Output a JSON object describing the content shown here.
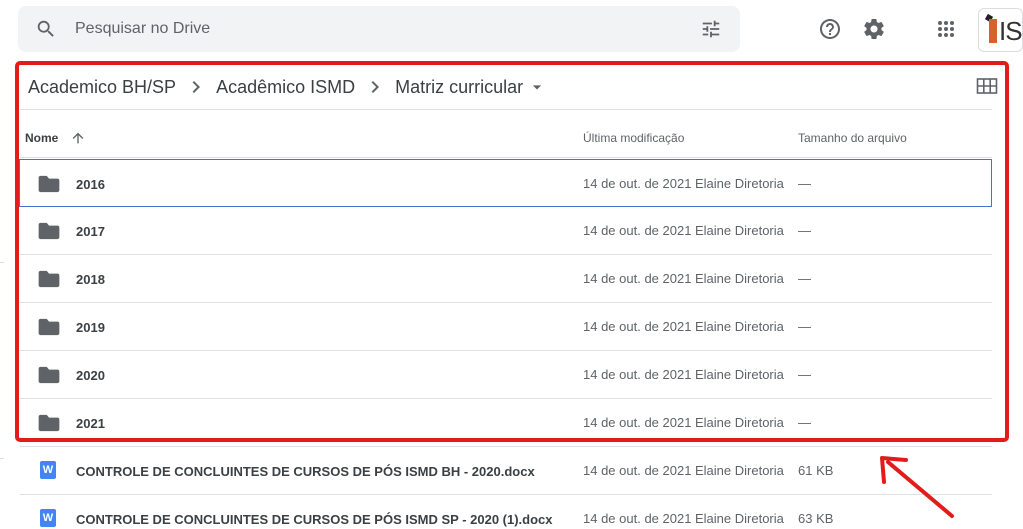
{
  "search": {
    "placeholder": "Pesquisar no Drive"
  },
  "header": {
    "icons": [
      "search-icon",
      "tune-icon",
      "help-icon",
      "gear-icon",
      "apps-icon"
    ],
    "logo_text": "IS"
  },
  "breadcrumb": {
    "items": [
      "Academico BH/SP",
      "Acadêmico ISMD",
      "Matriz curricular"
    ]
  },
  "columns": {
    "name": "Nome",
    "modified": "Última modificação",
    "size": "Tamanho do arquivo"
  },
  "files": [
    {
      "type": "folder",
      "name": "2016",
      "date": "14 de out. de 2021",
      "owner": "Elaine Diretoria",
      "size": "—"
    },
    {
      "type": "folder",
      "name": "2017",
      "date": "14 de out. de 2021",
      "owner": "Elaine Diretoria",
      "size": "—"
    },
    {
      "type": "folder",
      "name": "2018",
      "date": "14 de out. de 2021",
      "owner": "Elaine Diretoria",
      "size": "—"
    },
    {
      "type": "folder",
      "name": "2019",
      "date": "14 de out. de 2021",
      "owner": "Elaine Diretoria",
      "size": "—"
    },
    {
      "type": "folder",
      "name": "2020",
      "date": "14 de out. de 2021",
      "owner": "Elaine Diretoria",
      "size": "—"
    },
    {
      "type": "folder",
      "name": "2021",
      "date": "14 de out. de 2021",
      "owner": "Elaine Diretoria",
      "size": "—"
    },
    {
      "type": "docx",
      "icon_letter": "W",
      "name": "CONTROLE DE CONCLUINTES DE CURSOS DE PÓS ISMD BH - 2020.docx",
      "date": "14 de out. de 2021",
      "owner": "Elaine Diretoria",
      "size": "61 KB"
    },
    {
      "type": "docx",
      "icon_letter": "W",
      "name": "CONTROLE DE CONCLUINTES DE CURSOS DE PÓS ISMD SP - 2020 (1).docx",
      "date": "14 de out. de 2021",
      "owner": "Elaine Diretoria",
      "size": "63 KB"
    }
  ],
  "colors": {
    "highlight": "#e31b1b",
    "selection": "#4a6fd0",
    "folder": "#5f6368",
    "doc_icon": "#4285f4"
  }
}
